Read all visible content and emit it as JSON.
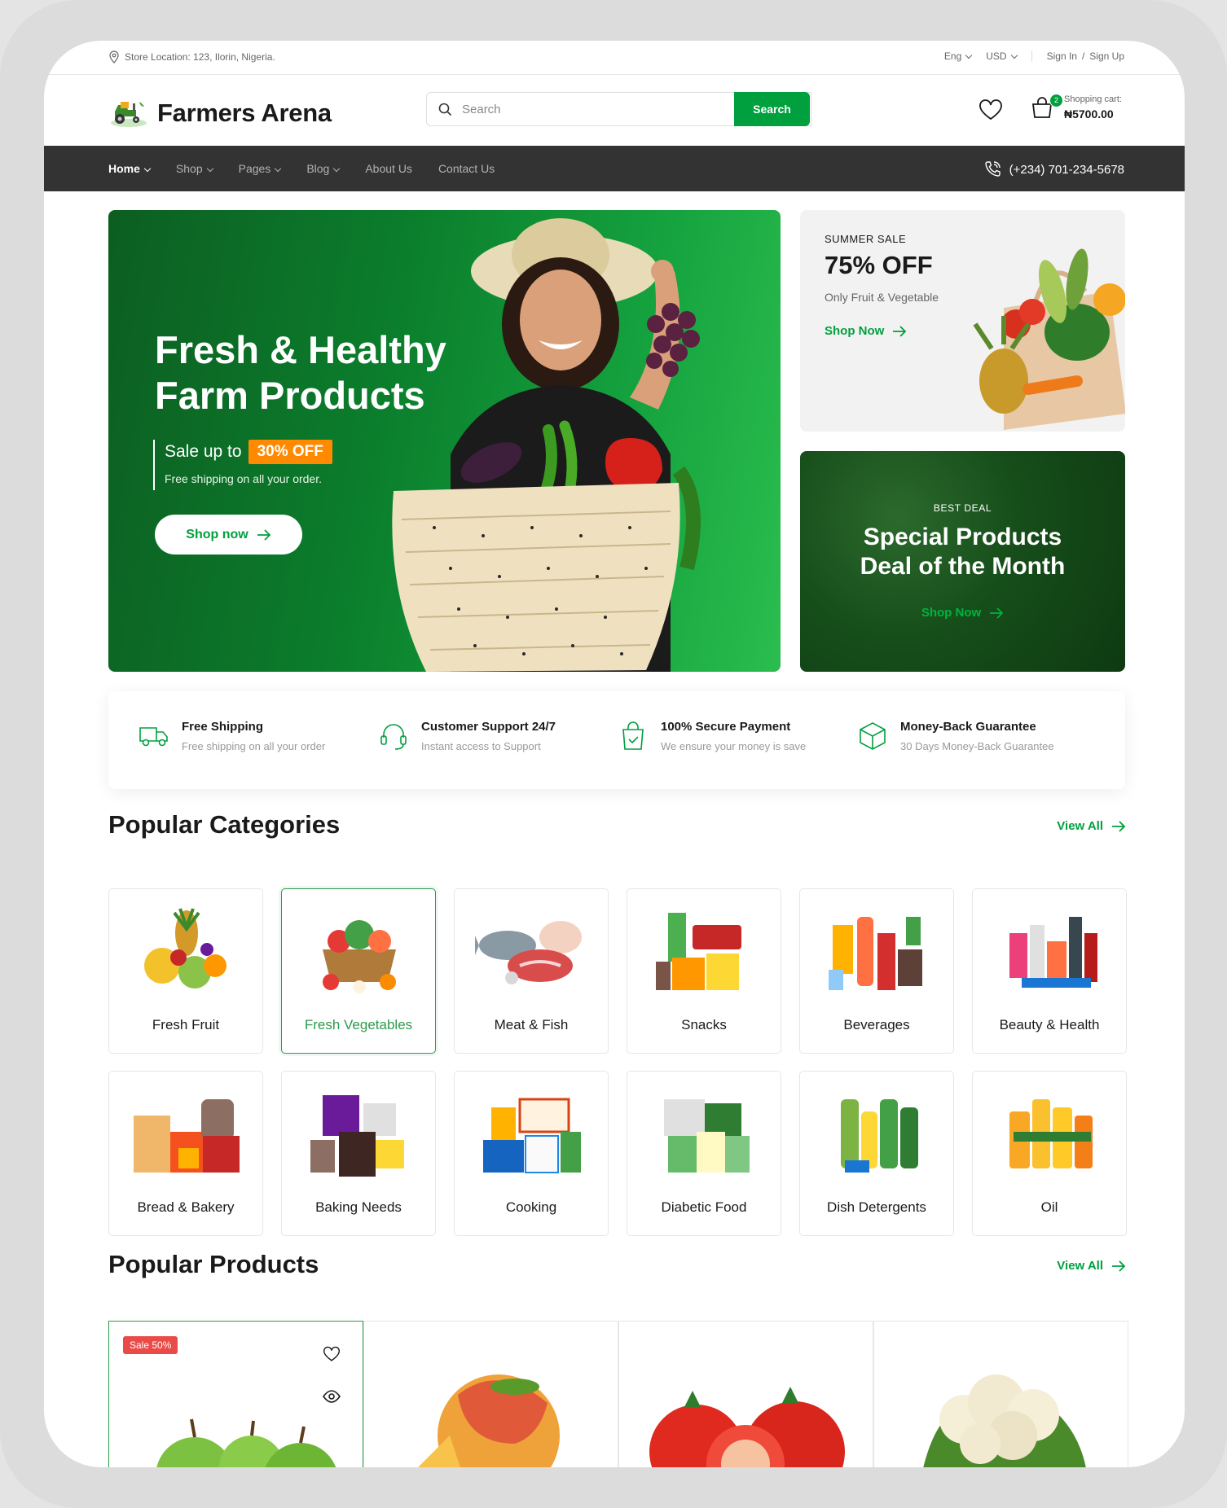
{
  "topbar": {
    "location": "Store Location: 123, Ilorin, Nigeria.",
    "language": "Eng",
    "currency": "USD",
    "sign_in": "Sign In",
    "divider": "/",
    "sign_up": "Sign Up"
  },
  "header": {
    "logo_text": "Farmers Arena",
    "search_placeholder": "Search",
    "search_button": "Search",
    "cart_count": "2",
    "cart_label": "Shopping cart:",
    "cart_amount": "₦5700.00"
  },
  "nav": {
    "items": [
      {
        "label": "Home"
      },
      {
        "label": "Shop"
      },
      {
        "label": "Pages"
      },
      {
        "label": "Blog"
      },
      {
        "label": "About Us"
      },
      {
        "label": "Contact Us"
      }
    ],
    "phone": "(+234) 701-234-5678"
  },
  "hero": {
    "title_line1": "Fresh & Healthy",
    "title_line2": "Farm Products",
    "sale_prefix": "Sale up to",
    "sale_badge": "30% OFF",
    "sale_sub": "Free shipping on all your order.",
    "cta": "Shop now"
  },
  "promo_summer": {
    "kicker": "SUMMER SALE",
    "headline": "75% OFF",
    "sub": "Only Fruit & Vegetable",
    "cta": "Shop Now"
  },
  "promo_deal": {
    "kicker": "BEST DEAL",
    "title_line1": "Special Products",
    "title_line2": "Deal of the Month",
    "cta": "Shop Now"
  },
  "features": [
    {
      "title": "Free Shipping",
      "sub": "Free shipping on all your order",
      "icon": "truck-icon"
    },
    {
      "title": "Customer Support 24/7",
      "sub": "Instant access to Support",
      "icon": "headset-icon"
    },
    {
      "title": "100% Secure Payment",
      "sub": "We ensure your money is save",
      "icon": "shopping-bag-icon"
    },
    {
      "title": "Money-Back Guarantee",
      "sub": "30 Days Money-Back Guarantee",
      "icon": "box-icon"
    }
  ],
  "categories": {
    "title": "Popular Categories",
    "view_all": "View All",
    "items": [
      {
        "name": "Fresh Fruit"
      },
      {
        "name": "Fresh Vegetables"
      },
      {
        "name": "Meat & Fish"
      },
      {
        "name": "Snacks"
      },
      {
        "name": "Beverages"
      },
      {
        "name": "Beauty & Health"
      },
      {
        "name": "Bread & Bakery"
      },
      {
        "name": "Baking Needs"
      },
      {
        "name": "Cooking"
      },
      {
        "name": "Diabetic Food"
      },
      {
        "name": "Dish Detergents"
      },
      {
        "name": "Oil"
      }
    ]
  },
  "products": {
    "title": "Popular Products",
    "view_all": "View All",
    "sale_badge": "Sale 50%"
  },
  "colors": {
    "brand_green": "#00a03e",
    "nav_bg": "#333333",
    "sale_orange": "#ff8a00",
    "sale_red": "#ea4b48"
  }
}
